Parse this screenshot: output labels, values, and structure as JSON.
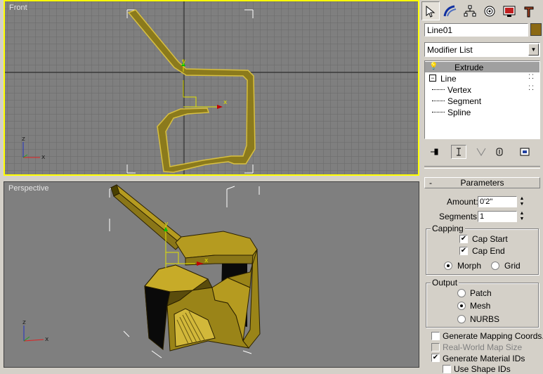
{
  "viewports": {
    "front": {
      "label": "Front"
    },
    "perspective": {
      "label": "Perspective"
    }
  },
  "axes": {
    "x": "x",
    "y": "y",
    "z": "z"
  },
  "panel": {
    "tabs": [
      "create-icon",
      "modify-icon",
      "hierarchy-icon",
      "motion-icon",
      "display-icon",
      "utilities-icon"
    ],
    "object_name": "Line01",
    "object_color": "#8b6914",
    "modifier_list": "Modifier List",
    "stack": {
      "extrude": "Extrude",
      "line": "Line",
      "vertex": "Vertex",
      "segment": "Segment",
      "spline": "Spline"
    },
    "parameters": {
      "title": "Parameters",
      "collapse": "-",
      "amount_label": "Amount:",
      "amount_value": "0'2\"",
      "segments_label": "Segments:",
      "segments_value": "1",
      "capping": {
        "title": "Capping",
        "cap_start": "Cap Start",
        "cap_end": "Cap End",
        "morph": "Morph",
        "grid": "Grid"
      },
      "output": {
        "title": "Output",
        "patch": "Patch",
        "mesh": "Mesh",
        "nurbs": "NURBS"
      },
      "gen_mapping": "Generate Mapping Coords.",
      "real_world": "Real-World Map Size",
      "gen_material": "Generate Material IDs",
      "use_shape": "Use Shape IDs"
    }
  }
}
